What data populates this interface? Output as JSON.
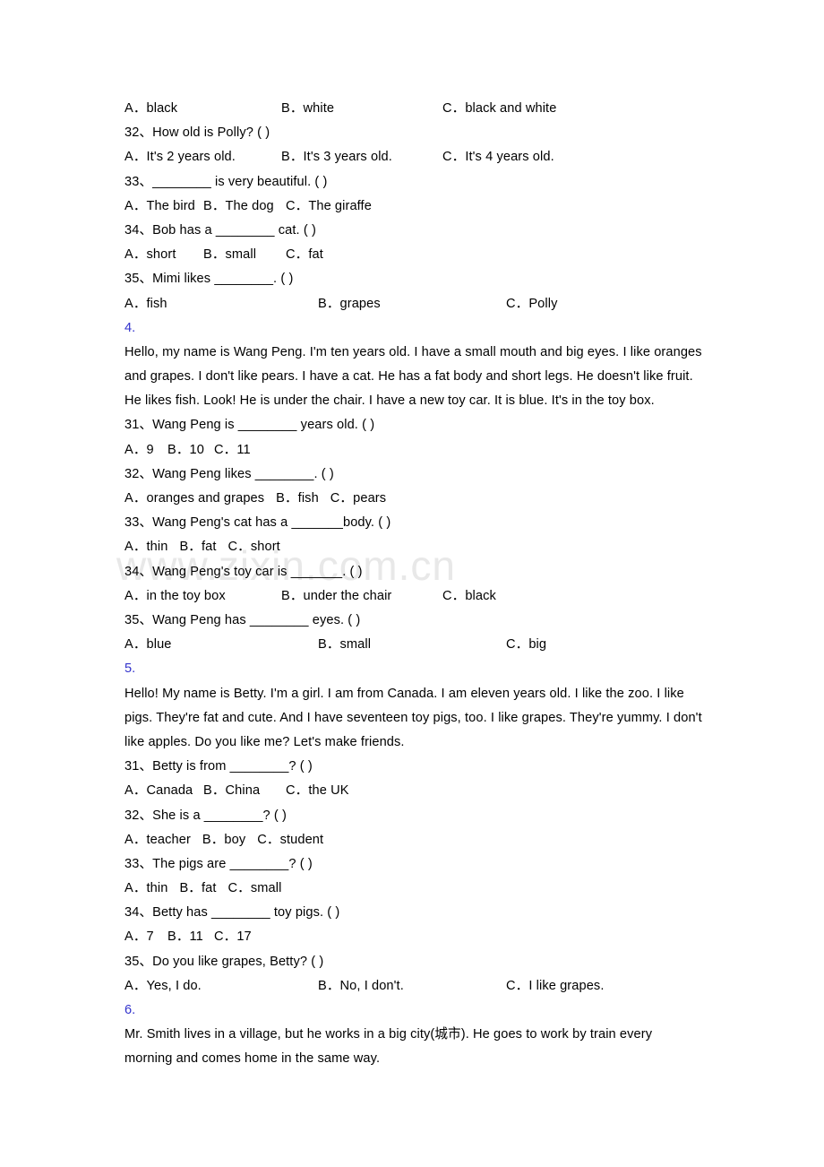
{
  "watermark": {
    "text": "www.zixin.com.cn",
    "color": "#e8e8e8"
  },
  "colors": {
    "section_number": "#3333cc",
    "text": "#000000",
    "page_background": "#ffffff"
  },
  "blocks": [
    {
      "kind": "options",
      "spacing": "med",
      "name": "options-row-q31-prev",
      "opts": [
        "A．black",
        "B．white",
        "C．black and white"
      ]
    },
    {
      "kind": "question",
      "name": "question-32-prev",
      "text": "32、How old is Polly? (  )"
    },
    {
      "kind": "options",
      "spacing": "med",
      "name": "options-row-q32-prev",
      "opts": [
        "A．It's 2 years old.",
        "B．It's 3 years old.",
        "C．It's 4 years old."
      ]
    },
    {
      "kind": "question",
      "name": "question-33-prev",
      "text": "33、________ is very beautiful. (  )"
    },
    {
      "kind": "options",
      "spacing": "narrow",
      "name": "options-row-q33-prev",
      "opts": [
        "A．The bird",
        "B．The dog",
        "C．The giraffe"
      ]
    },
    {
      "kind": "question",
      "name": "question-34-prev",
      "text": "34、Bob has a ________ cat. (  )"
    },
    {
      "kind": "options",
      "spacing": "narrow",
      "name": "options-row-q34-prev",
      "opts": [
        "A．short",
        "B．small",
        "C．fat"
      ]
    },
    {
      "kind": "question",
      "name": "question-35-prev",
      "text": "35、Mimi likes ________. (  )"
    },
    {
      "kind": "options",
      "spacing": "wide",
      "name": "options-row-q35-prev",
      "opts": [
        "A．fish",
        "B．grapes",
        "C．Polly"
      ]
    },
    {
      "kind": "secnum",
      "name": "section-number-4",
      "text": "4."
    },
    {
      "kind": "passage",
      "name": "passage-4",
      "text": "Hello, my name is Wang Peng. I'm ten years old. I have a small mouth and big eyes. I like oranges and grapes. I don't like pears. I have a cat. He has a fat body and short legs. He doesn't like fruit. He likes fish. Look! He is under the chair. I have a new toy car. It is blue. It's in the toy box."
    },
    {
      "kind": "question",
      "name": "question-31-p4",
      "text": "31、Wang Peng is ________ years old. (  )"
    },
    {
      "kind": "options",
      "spacing": "num",
      "name": "options-row-q31-p4",
      "opts": [
        "A．9",
        "B．10",
        "C．11"
      ]
    },
    {
      "kind": "question",
      "name": "question-32-p4",
      "text": "32、Wang Peng likes ________. (  )"
    },
    {
      "kind": "options",
      "spacing": "flow",
      "name": "options-row-q32-p4",
      "opts": [
        "A．oranges and grapes",
        "B．fish",
        "C．pears"
      ]
    },
    {
      "kind": "question",
      "name": "question-33-p4",
      "text": "33、Wang Peng's cat has a _______body. (  )"
    },
    {
      "kind": "options",
      "spacing": "flow",
      "name": "options-row-q33-p4",
      "opts": [
        "A．thin",
        "B．fat",
        "C．short"
      ]
    },
    {
      "kind": "question",
      "name": "question-34-p4",
      "text": "34、Wang Peng's toy car is _______. (  )"
    },
    {
      "kind": "options",
      "spacing": "med",
      "name": "options-row-q34-p4",
      "opts": [
        "A．in the toy box",
        "B．under the chair",
        "C．black"
      ]
    },
    {
      "kind": "question",
      "name": "question-35-p4",
      "text": "35、Wang Peng has ________ eyes. (  )"
    },
    {
      "kind": "options",
      "spacing": "wide",
      "name": "options-row-q35-p4",
      "opts": [
        "A．blue",
        "B．small",
        "C．big"
      ]
    },
    {
      "kind": "secnum",
      "name": "section-number-5",
      "text": "5."
    },
    {
      "kind": "passage",
      "name": "passage-5",
      "text": "Hello! My name is Betty. I'm a girl. I am from Canada. I am eleven years old. I like the zoo. I like pigs. They're fat and cute. And I have seventeen toy pigs, too. I like grapes. They're yummy. I don't like apples. Do you like me? Let's make friends."
    },
    {
      "kind": "question",
      "name": "question-31-p5",
      "text": "31、Betty is from ________? (  )"
    },
    {
      "kind": "options",
      "spacing": "narrow",
      "name": "options-row-q31-p5",
      "opts": [
        "A．Canada",
        "B．China",
        "C．the UK"
      ]
    },
    {
      "kind": "question",
      "name": "question-32-p5",
      "text": "32、She is a ________? (  )"
    },
    {
      "kind": "options",
      "spacing": "flow",
      "name": "options-row-q32-p5",
      "opts": [
        "A．teacher",
        "B．boy",
        "C．student"
      ]
    },
    {
      "kind": "question",
      "name": "question-33-p5",
      "text": "33、The pigs are ________? (  )"
    },
    {
      "kind": "options",
      "spacing": "flow",
      "name": "options-row-q33-p5",
      "opts": [
        "A．thin",
        "B．fat",
        "C．small"
      ]
    },
    {
      "kind": "question",
      "name": "question-34-p5",
      "text": "34、Betty has ________ toy pigs. (  )"
    },
    {
      "kind": "options",
      "spacing": "num",
      "name": "options-row-q34-p5",
      "opts": [
        "A．7",
        "B．11",
        "C．17"
      ]
    },
    {
      "kind": "question",
      "name": "question-35-p5",
      "text": "35、Do you like grapes, Betty? (  )"
    },
    {
      "kind": "options",
      "spacing": "wide",
      "name": "options-row-q35-p5",
      "opts": [
        "A．Yes, I do.",
        "B．No, I don't.",
        "C．I like grapes."
      ]
    },
    {
      "kind": "secnum",
      "name": "section-number-6",
      "text": "6."
    },
    {
      "kind": "passage",
      "name": "passage-6",
      "text": "Mr. Smith lives in a village, but he works in a big city(城市). He goes to work by train every morning and comes home in the same way."
    }
  ]
}
